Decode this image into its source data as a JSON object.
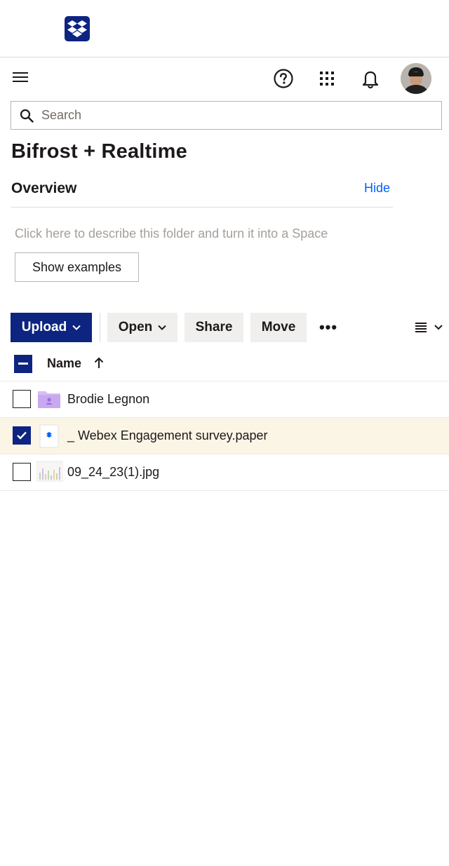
{
  "header": {
    "logo_icon": "dropbox-logo-icon",
    "brand_color": "#0d2481"
  },
  "topbar": {
    "menu_icon": "hamburger-menu-icon",
    "help_icon": "help-circle-icon",
    "apps_icon": "apps-grid-icon",
    "notifications_icon": "bell-icon",
    "avatar_icon": "user-avatar"
  },
  "search": {
    "placeholder": "Search",
    "value": ""
  },
  "folder": {
    "title": "Bifrost + Realtime"
  },
  "overview": {
    "title": "Overview",
    "hide_label": "Hide",
    "description_prompt": "Click here to describe this folder and turn it into a Space",
    "show_examples_label": "Show examples"
  },
  "toolbar": {
    "upload_label": "Upload",
    "open_label": "Open",
    "share_label": "Share",
    "move_label": "Move",
    "more_label": "•••",
    "view_icon": "list-view-icon"
  },
  "list": {
    "name_header": "Name",
    "sort": "ascending",
    "select_all_state": "indeterminate",
    "items": [
      {
        "name": "Brodie Legnon",
        "type": "shared-folder",
        "icon": "shared-folder-icon",
        "checked": false
      },
      {
        "name": "_ Webex Engagement survey.paper",
        "type": "paper",
        "icon": "paper-doc-icon",
        "checked": true
      },
      {
        "name": "09_24_23(1).jpg",
        "type": "image",
        "icon": "image-thumbnail",
        "checked": false
      }
    ]
  },
  "colors": {
    "accent": "#0d2481",
    "link": "#0061fe",
    "selected_row": "#fbf5e6",
    "secondary_button": "#f0efed",
    "folder_purple": "#d7bdf5"
  }
}
